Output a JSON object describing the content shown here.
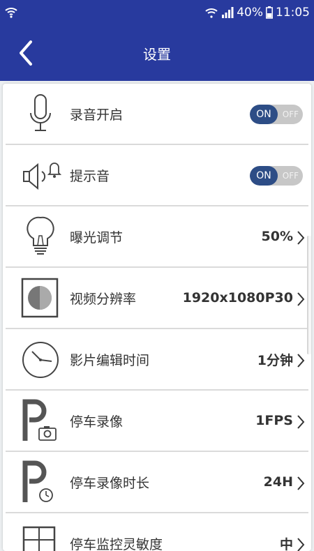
{
  "status": {
    "battery": "40%",
    "time": "11:05"
  },
  "header": {
    "title": "设置",
    "back_icon": "back-chevron-icon"
  },
  "settings": [
    {
      "label": "录音开启",
      "icon": "microphone-icon",
      "toggle": {
        "on": "ON",
        "off": "OFF"
      }
    },
    {
      "label": "提示音",
      "icon": "speaker-bell-icon",
      "toggle": {
        "on": "ON",
        "off": "OFF"
      }
    },
    {
      "label": "曝光调节",
      "icon": "light-bulb-icon",
      "value": "50%"
    },
    {
      "label": "视频分辨率",
      "icon": "resolution-icon",
      "value": "1920x1080P30"
    },
    {
      "label": "影片编辑时间",
      "icon": "clock-icon",
      "value": "1分钟"
    },
    {
      "label": "停车录像",
      "icon": "parking-camera-icon",
      "value": "1FPS"
    },
    {
      "label": "停车录像时长",
      "icon": "parking-timer-icon",
      "value": "24H"
    },
    {
      "label": "停车监控灵敏度",
      "icon": "parking-monitor-icon",
      "value": "中"
    }
  ],
  "colors": {
    "app_bar": "#283a9e",
    "toggle_on": "#2d4d86",
    "toggle_track": "#c7c7c7"
  }
}
